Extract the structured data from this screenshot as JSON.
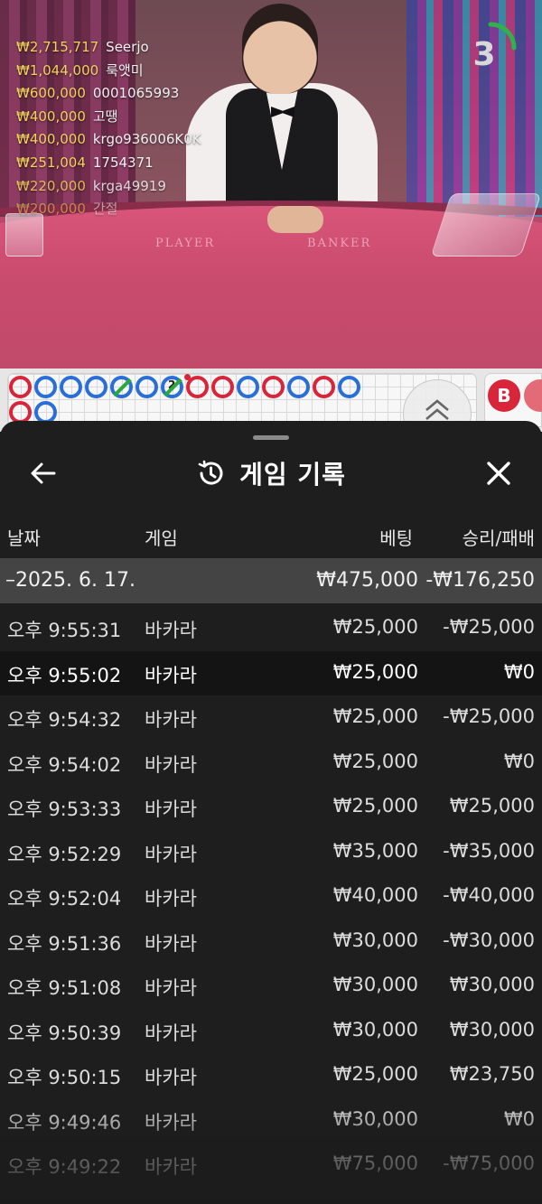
{
  "live": {
    "timer": "3",
    "table_labels": {
      "player": "PLAYER",
      "banker": "BANKER"
    },
    "winners": [
      {
        "amount": "₩2,715,717",
        "name": "Seerjo"
      },
      {
        "amount": "₩1,044,000",
        "name": "룩앳미"
      },
      {
        "amount": "₩600,000",
        "name": "0001065993"
      },
      {
        "amount": "₩400,000",
        "name": "고땡"
      },
      {
        "amount": "₩400,000",
        "name": "krgo936006K0K"
      },
      {
        "amount": "₩251,004",
        "name": "1754371"
      },
      {
        "amount": "₩220,000",
        "name": "krga49919"
      },
      {
        "amount": "₩200,000",
        "name": "간절"
      }
    ]
  },
  "roadmap": {
    "beads_row1": [
      "B",
      "P",
      "P",
      "P",
      "T",
      "P",
      "T",
      "B",
      "B",
      "P",
      "B",
      "P",
      "B",
      "P"
    ],
    "bead_badge": "2",
    "beads_row2": [
      "B",
      "P"
    ],
    "side_label": "B",
    "colors": {
      "banker": "#d8253a",
      "player": "#2a6fd8",
      "tie": "#2aa83a"
    }
  },
  "history": {
    "title": "게임 기록",
    "icons": {
      "back": "arrow-left-icon",
      "history": "history-clock-icon",
      "close": "close-icon"
    },
    "columns": {
      "date": "날짜",
      "game": "게임",
      "bet": "베팅",
      "result": "승리/패배"
    },
    "date_group": {
      "date": "–2025. 6. 17.",
      "bet_total": "₩475,000",
      "result_total": "-₩176,250"
    },
    "rows": [
      {
        "time": "오후 9:55:31",
        "game": "바카라",
        "bet": "₩25,000",
        "result": "-₩25,000"
      },
      {
        "time": "오후 9:55:02",
        "game": "바카라",
        "bet": "₩25,000",
        "result": "₩0"
      },
      {
        "time": "오후 9:54:32",
        "game": "바카라",
        "bet": "₩25,000",
        "result": "-₩25,000"
      },
      {
        "time": "오후 9:54:02",
        "game": "바카라",
        "bet": "₩25,000",
        "result": "₩0"
      },
      {
        "time": "오후 9:53:33",
        "game": "바카라",
        "bet": "₩25,000",
        "result": "₩25,000"
      },
      {
        "time": "오후 9:52:29",
        "game": "바카라",
        "bet": "₩35,000",
        "result": "-₩35,000"
      },
      {
        "time": "오후 9:52:04",
        "game": "바카라",
        "bet": "₩40,000",
        "result": "-₩40,000"
      },
      {
        "time": "오후 9:51:36",
        "game": "바카라",
        "bet": "₩30,000",
        "result": "-₩30,000"
      },
      {
        "time": "오후 9:51:08",
        "game": "바카라",
        "bet": "₩30,000",
        "result": "₩30,000"
      },
      {
        "time": "오후 9:50:39",
        "game": "바카라",
        "bet": "₩30,000",
        "result": "₩30,000"
      },
      {
        "time": "오후 9:50:15",
        "game": "바카라",
        "bet": "₩25,000",
        "result": "₩23,750"
      },
      {
        "time": "오후 9:49:46",
        "game": "바카라",
        "bet": "₩30,000",
        "result": "₩0"
      },
      {
        "time": "오후 9:49:22",
        "game": "바카라",
        "bet": "₩75,000",
        "result": "-₩75,000"
      }
    ]
  }
}
